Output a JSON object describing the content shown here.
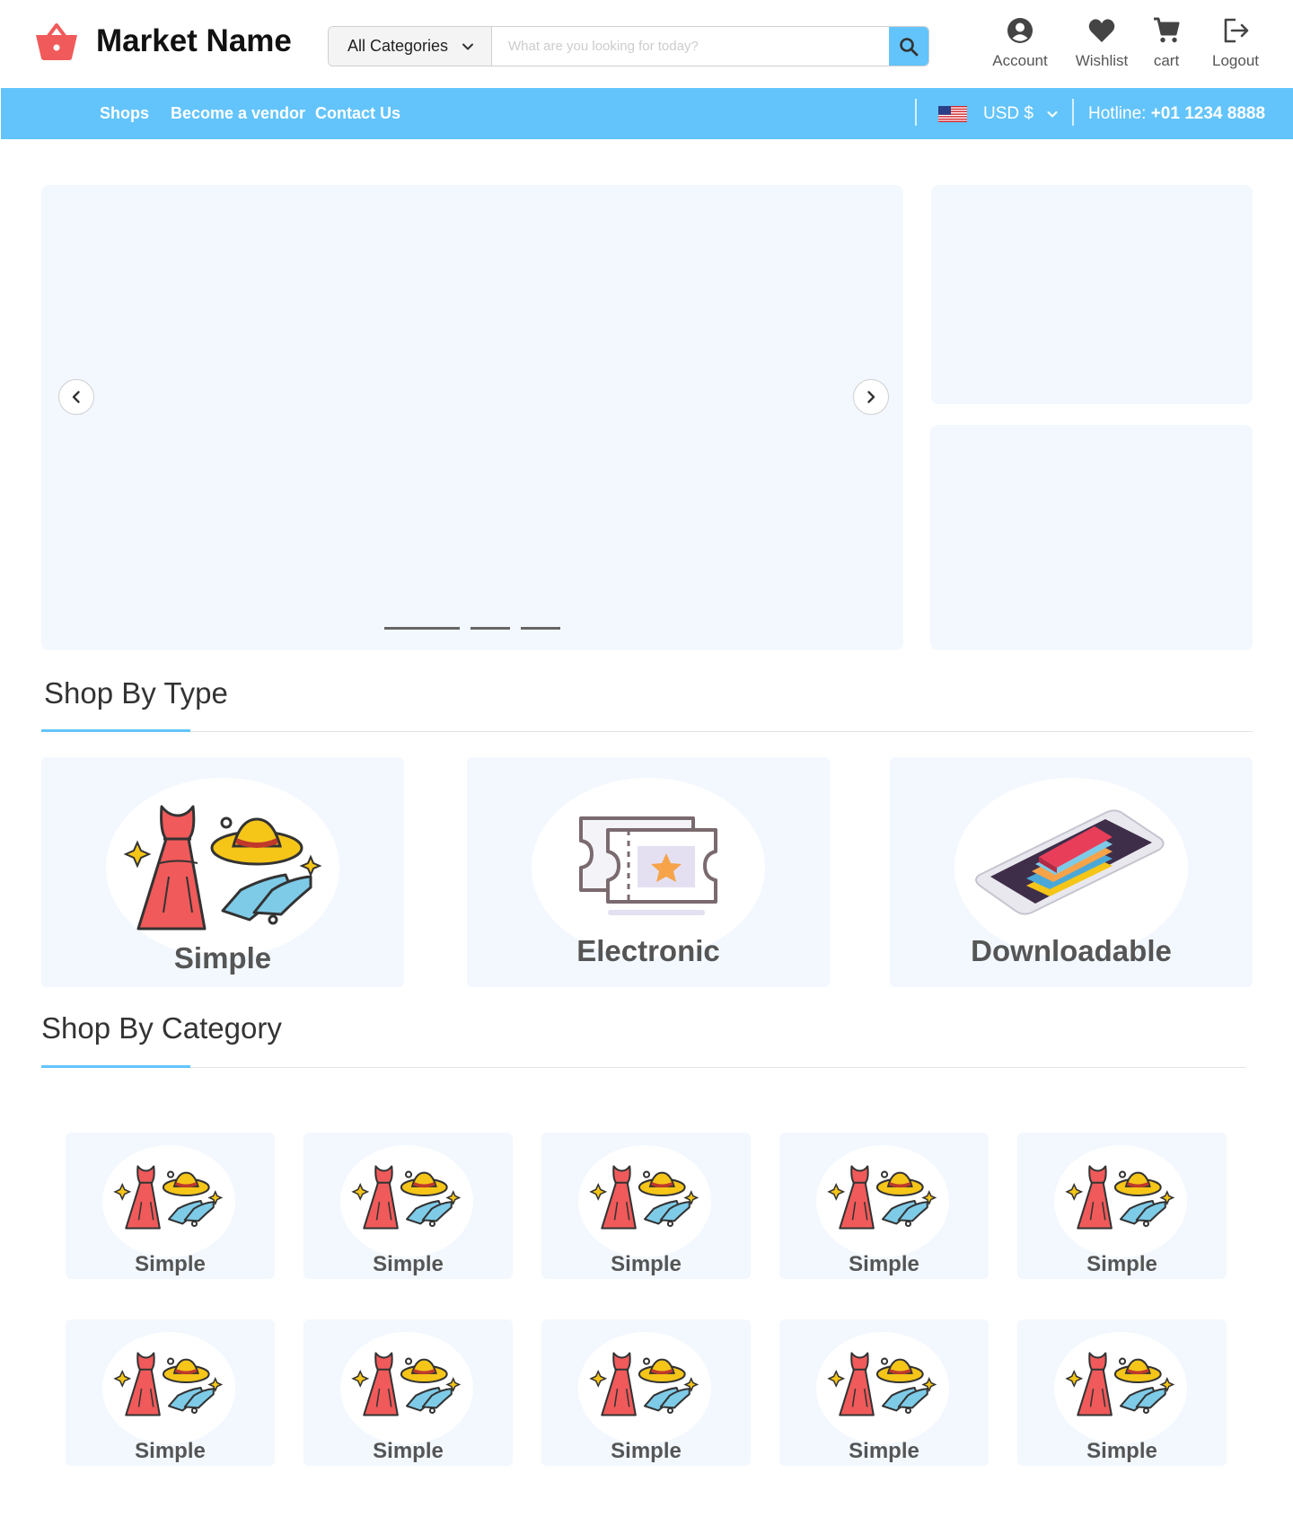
{
  "header": {
    "market_name": "Market Name",
    "search": {
      "category_label": "All Categories",
      "placeholder": "What are you looking for today?"
    },
    "actions": [
      {
        "label": "Account",
        "icon": "account-circle-icon"
      },
      {
        "label": "Wishlist",
        "icon": "heart-icon"
      },
      {
        "label": "cart",
        "icon": "cart-icon"
      },
      {
        "label": "Logout",
        "icon": "logout-icon"
      }
    ]
  },
  "nav": {
    "links": [
      "Shops",
      "Become a vendor",
      "Contact Us"
    ],
    "currency": "USD $",
    "hotline_label": "Hotline:",
    "hotline_number": "+01 1234 8888"
  },
  "hero": {
    "slide_count": 3,
    "active_slide": 1
  },
  "shop_by_type": {
    "title": "Shop By Type",
    "items": [
      {
        "label": "Simple",
        "icon": "fashion-dress-hat-shoes-icon"
      },
      {
        "label": "Electronic",
        "icon": "ticket-star-icon"
      },
      {
        "label": "Downloadable",
        "icon": "phone-books-icon"
      }
    ]
  },
  "shop_by_category": {
    "title": "Shop By Category",
    "items": [
      {
        "label": "Simple"
      },
      {
        "label": "Simple"
      },
      {
        "label": "Simple"
      },
      {
        "label": "Simple"
      },
      {
        "label": "Simple"
      },
      {
        "label": "Simple"
      },
      {
        "label": "Simple"
      },
      {
        "label": "Simple"
      },
      {
        "label": "Simple"
      },
      {
        "label": "Simple"
      }
    ]
  },
  "colors": {
    "accent": "#63c4fb",
    "logo": "#f05a5a",
    "card_bg": "#f2f8fe"
  }
}
